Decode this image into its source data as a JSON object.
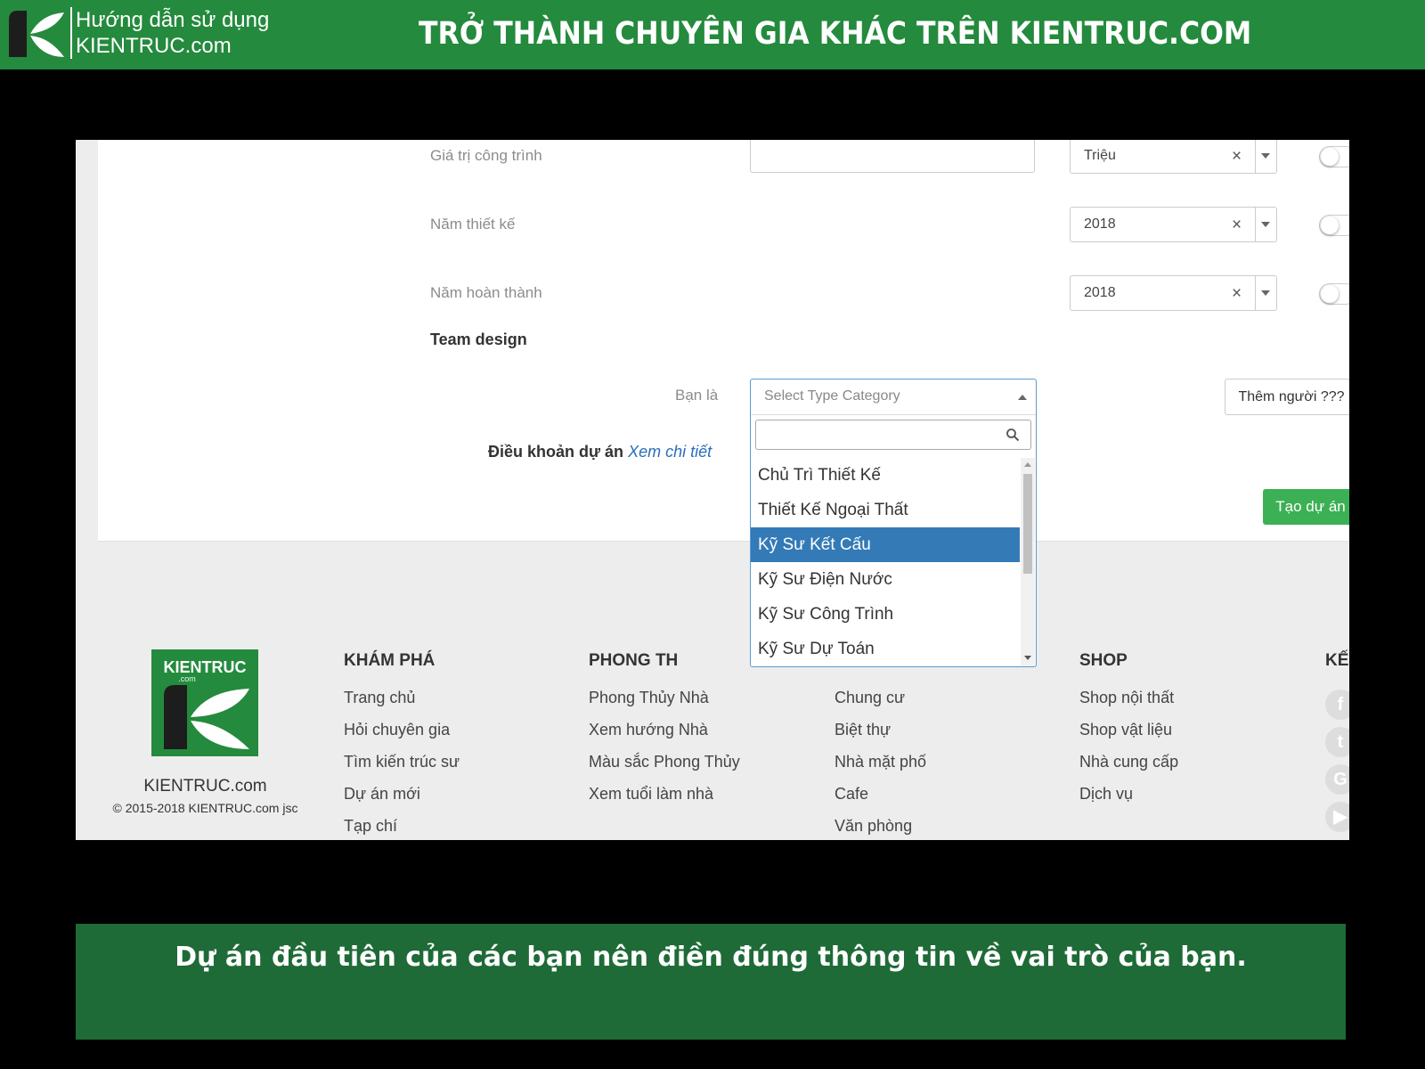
{
  "header": {
    "brand_line1": "Hướng dẫn sử dụng",
    "brand_line2": "KIENTRUC.com",
    "title": "TRỞ THÀNH CHUYÊN GIA KHÁC TRÊN KIENTRUC.COM",
    "bg_color": "#248a3d"
  },
  "form": {
    "value_label": "Giá trị công trình",
    "value_unit": "Triệu",
    "design_year_label": "Năm thiết kế",
    "design_year": "2018",
    "done_year_label": "Năm hoàn thành",
    "done_year": "2018",
    "team_heading": "Team design",
    "role_label": "Bạn là",
    "role_placeholder": "Select Type Category",
    "terms_label": "Điều khoản dự án",
    "terms_link": "Xem chi tiết",
    "add_person_button": "Thêm người ???",
    "create_button": "Tạo dự án",
    "clear_symbol": "×"
  },
  "dropdown": {
    "options": [
      "Chủ Trì Thiết Kế",
      "Thiết Kế Ngoại Thất",
      "Kỹ Sư Kết Cấu",
      "Kỹ Sư Điện Nước",
      "Kỹ Sư Công Trình",
      "Kỹ Sư Dự Toán"
    ],
    "selected": "Kỹ Sư Kết Cấu",
    "highlight_color": "#337ab7"
  },
  "footer": {
    "brand": "KIENTRUC.com",
    "logo_text": "KIENTRUC",
    "logo_sub": ".com",
    "copyright": "© 2015-2018 KIENTRUC.com jsc",
    "columns": [
      {
        "heading": "KHÁM PHÁ",
        "items": [
          "Trang chủ",
          "Hỏi chuyên gia",
          "Tìm kiến trúc sư",
          "Dự án mới",
          "Tạp chí"
        ]
      },
      {
        "heading": "PHONG TH",
        "items": [
          "Phong Thủy Nhà",
          "Xem hướng Nhà",
          "Màu sắc Phong Thủy",
          "Xem tuổi làm nhà"
        ]
      },
      {
        "heading": "",
        "items": [
          "Chung cư",
          "Biệt thự",
          "Nhà mặt phố",
          "Cafe",
          "Văn phòng"
        ]
      },
      {
        "heading": "SHOP",
        "items": [
          "Shop nội thất",
          "Shop vật liệu",
          "Nhà cung cấp",
          "Dịch vụ"
        ]
      },
      {
        "heading": "KẾ",
        "items": []
      }
    ],
    "social_icons": [
      "facebook-icon",
      "twitter-icon",
      "google-plus-icon",
      "youtube-icon"
    ],
    "social_glyphs": [
      "f",
      "t",
      "G",
      "▶"
    ]
  },
  "caption": {
    "text": "Dự án đầu tiên của các bạn nên điền đúng thông tin về vai trò của bạn.",
    "bg_color": "#1e6b37"
  }
}
